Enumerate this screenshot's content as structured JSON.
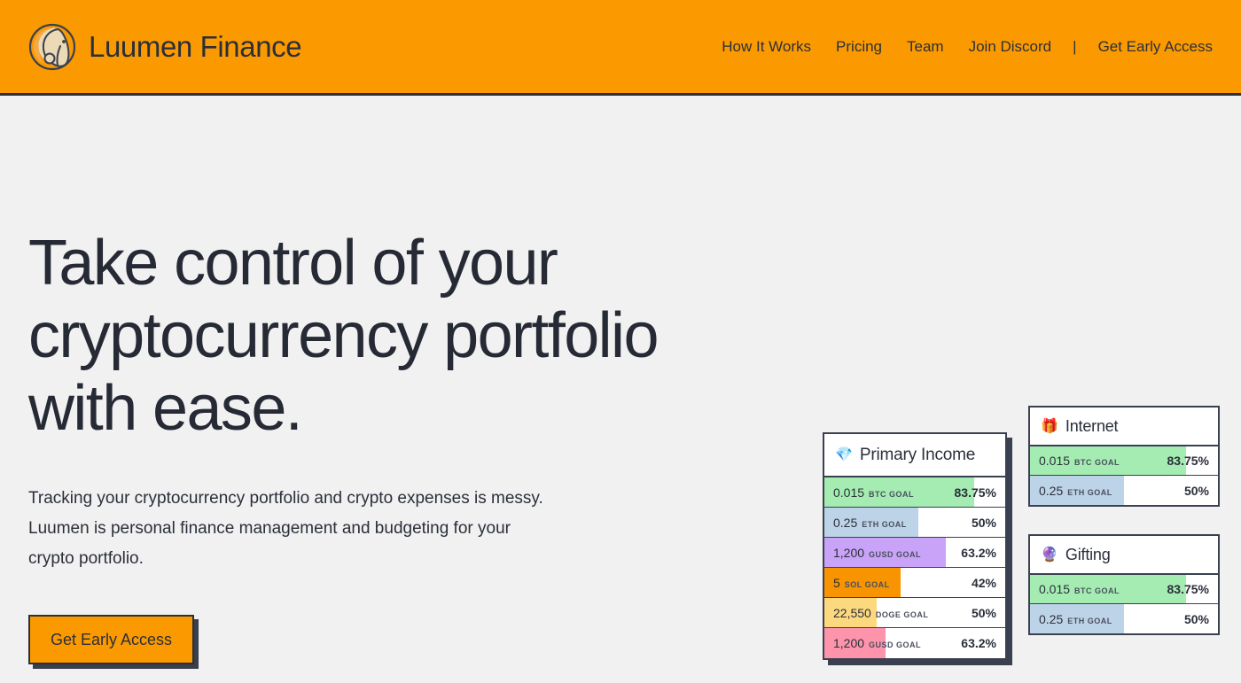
{
  "header": {
    "brand_name": "Luumen Finance",
    "logo_icon": "luumen-elephant-logo",
    "nav": [
      {
        "label": "How It Works",
        "name": "how-it-works"
      },
      {
        "label": "Pricing",
        "name": "pricing"
      },
      {
        "label": "Team",
        "name": "team"
      },
      {
        "label": "Join Discord",
        "name": "join-discord"
      }
    ],
    "separator": "|",
    "cta_label": "Get Early Access",
    "background_color": "#fb9a00",
    "text_color": "#2b2f3a"
  },
  "hero": {
    "title": "Take control of your cryptocurrency portfolio with ease.",
    "subtitle": "Tracking your cryptocurrency portfolio and crypto expenses is messy. Luumen is personal finance management and budgeting for your crypto portfolio.",
    "cta_label": "Get Early Access",
    "background_color": "#f1f1f1"
  },
  "cards": [
    {
      "name": "primary-income",
      "icon": "💎",
      "icon_name": "gem-icon",
      "title": "Primary Income",
      "rows": [
        {
          "amount": "0.015",
          "unit": "BTC GOAL",
          "pct": "83.75%",
          "fill": 83,
          "color": "#a4ecb1"
        },
        {
          "amount": "0.25",
          "unit": "ETH GOAL",
          "pct": "50%",
          "fill": 52,
          "color": "#bdd4e8"
        },
        {
          "amount": "1,200",
          "unit": "GUSD GOAL",
          "pct": "63.2%",
          "fill": 67,
          "color": "#c9a3f7"
        },
        {
          "amount": "5",
          "unit": "SOL GOAL",
          "pct": "42%",
          "fill": 42,
          "color": "#f79400"
        },
        {
          "amount": "22,550",
          "unit": "DOGE GOAL",
          "pct": "50%",
          "fill": 29,
          "color": "#fcd97f"
        },
        {
          "amount": "1,200",
          "unit": "GUSD GOAL",
          "pct": "63.2%",
          "fill": 34,
          "color": "#fd94ab"
        }
      ]
    },
    {
      "name": "internet",
      "icon": "🎁",
      "icon_name": "gift-icon",
      "title": "Internet",
      "rows": [
        {
          "amount": "0.015",
          "unit": "BTC GOAL",
          "pct": "83.75%",
          "fill": 83,
          "color": "#a4ecb1"
        },
        {
          "amount": "0.25",
          "unit": "ETH GOAL",
          "pct": "50%",
          "fill": 50,
          "color": "#bdd4e8"
        }
      ]
    },
    {
      "name": "gifting",
      "icon": "🔮",
      "icon_name": "crystal-ball-icon",
      "title": "Gifting",
      "rows": [
        {
          "amount": "0.015",
          "unit": "BTC GOAL",
          "pct": "83.75%",
          "fill": 83,
          "color": "#a4ecb1"
        },
        {
          "amount": "0.25",
          "unit": "ETH GOAL",
          "pct": "50%",
          "fill": 50,
          "color": "#bdd4e8"
        }
      ]
    }
  ]
}
